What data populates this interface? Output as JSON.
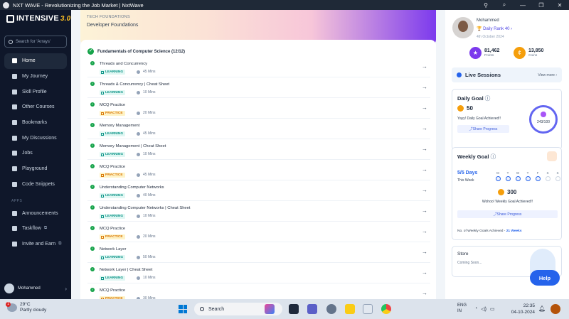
{
  "window": {
    "title": "NXT WAVE - Revolutionizing the Job Market | NxtWave",
    "buttons": [
      "⚲",
      "⌕",
      "—",
      "❐",
      "✕"
    ]
  },
  "sidebar": {
    "brand": "INTENSIVE",
    "brand_version": "3.0",
    "search_placeholder": "Search for 'Arrays'",
    "items": [
      {
        "label": "Home",
        "icon": "home-icon",
        "active": true
      },
      {
        "label": "My Journey",
        "icon": "journey-icon"
      },
      {
        "label": "Skill Profile",
        "icon": "profile-icon"
      },
      {
        "label": "Other Courses",
        "icon": "courses-icon"
      },
      {
        "label": "Bookmarks",
        "icon": "bookmark-icon"
      },
      {
        "label": "My Discussions",
        "icon": "discussion-icon"
      },
      {
        "label": "Jobs",
        "icon": "jobs-icon"
      },
      {
        "label": "Playground",
        "icon": "playground-icon"
      },
      {
        "label": "Code Snippets",
        "icon": "code-icon"
      }
    ],
    "apps_label": "APPS",
    "apps": [
      {
        "label": "Announcements",
        "icon": "announcement-icon"
      },
      {
        "label": "Taskflow",
        "icon": "taskflow-icon",
        "ext": "⧉"
      },
      {
        "label": "Invite and Earn",
        "icon": "invite-icon",
        "ext": "⧉"
      }
    ],
    "user_name": "Mohammed"
  },
  "banner": {
    "label": "TECH FOUNDATIONS",
    "title": "Developer Foundations"
  },
  "course": {
    "heading": "Fundamentals of Computer Science (12/12)",
    "items": [
      {
        "title": "Threads and Concurrency",
        "tag": "LEARNING",
        "type": "learning",
        "duration": "45 Mins"
      },
      {
        "title": "Threads & Concurrency | Cheat Sheet",
        "tag": "LEARNING",
        "type": "learning",
        "duration": "10 Mins"
      },
      {
        "title": "MCQ Practice",
        "tag": "PRACTICE",
        "type": "practice",
        "duration": "20 Mins"
      },
      {
        "title": "Memory Management",
        "tag": "LEARNING",
        "type": "learning",
        "duration": "45 Mins"
      },
      {
        "title": "Memory Management | Cheat Sheet",
        "tag": "LEARNING",
        "type": "learning",
        "duration": "10 Mins"
      },
      {
        "title": "MCQ Practice",
        "tag": "PRACTICE",
        "type": "practice",
        "duration": "45 Mins"
      },
      {
        "title": "Understanding Computer Networks",
        "tag": "LEARNING",
        "type": "learning",
        "duration": "40 Mins"
      },
      {
        "title": "Understanding Computer Networks | Cheat Sheet",
        "tag": "LEARNING",
        "type": "learning",
        "duration": "10 Mins"
      },
      {
        "title": "MCQ Practice",
        "tag": "PRACTICE",
        "type": "practice",
        "duration": "20 Mins"
      },
      {
        "title": "Network Layer",
        "tag": "LEARNING",
        "type": "learning",
        "duration": "50 Mins"
      },
      {
        "title": "Network Layer | Cheat Sheet",
        "tag": "LEARNING",
        "type": "learning",
        "duration": "10 Mins"
      },
      {
        "title": "MCQ Practice",
        "tag": "PRACTICE",
        "type": "practice",
        "duration": "30 Mins"
      }
    ]
  },
  "profile": {
    "name": "Mohammed",
    "rank": "Daily Rank 40",
    "date": "4th October 2024",
    "points_value": "81,462",
    "points_label": "Points",
    "coins_value": "13,850",
    "coins_label": "Coins"
  },
  "live": {
    "title": "Live Sessions",
    "view_more": "View more"
  },
  "daily_goal": {
    "title": "Daily Goal",
    "points": "50",
    "achieved": "Yayy! Daily Goal Achieved!!",
    "share": "Share Progress",
    "progress_text": "243/100"
  },
  "weekly_goal": {
    "title": "Weekly Goal",
    "days": "5/5 Days",
    "this_week": "This Week",
    "day_labels": [
      "M",
      "T",
      "W",
      "T",
      "F",
      "S",
      "S"
    ],
    "day_done": [
      true,
      true,
      true,
      true,
      true,
      false,
      false
    ],
    "points": "300",
    "achieved": "Wohoo! Weekly Goal Achieved!!",
    "share": "Share Progress",
    "count_label": "No. of Weekly Goals Achieved -",
    "count_value": "21 Weeks"
  },
  "store": {
    "title": "Store",
    "subtitle": "Coming Soon..."
  },
  "help_label": "Help",
  "taskbar": {
    "temperature": "29°C",
    "weather": "Partly cloudy",
    "weather_badge": "1",
    "search": "Search",
    "lang1": "ENG",
    "lang2": "IN",
    "time": "22:35",
    "date": "04-10-2024"
  },
  "colors": {
    "accent": "#2563eb",
    "success": "#16a34a",
    "learning": "#0d9488",
    "practice": "#d97706",
    "sidebar_bg": "#0f172a"
  }
}
